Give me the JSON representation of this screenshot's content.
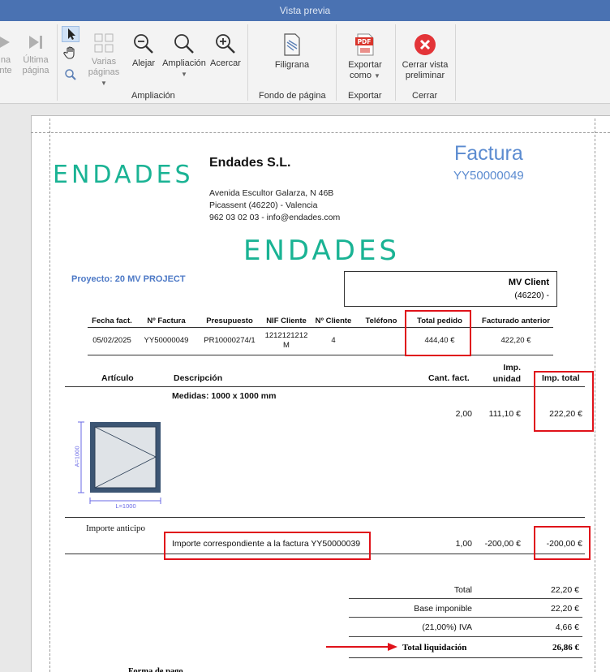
{
  "window": {
    "title": "Vista previa"
  },
  "ribbon": {
    "prev_label_line1": "na",
    "prev_label_line2": "nte",
    "last_label_line1": "Última",
    "last_label_line2": "página",
    "multi_label_line1": "Varias",
    "multi_label_line2": "páginas",
    "zoom_out_label": "Alejar",
    "zoom_label": "Ampliación",
    "zoom_in_label": "Acercar",
    "watermark_label": "Filigrana",
    "export_label_line1": "Exportar",
    "export_label_line2": "como",
    "close_label_line1": "Cerrar vista",
    "close_label_line2": "preliminar",
    "group_zoom": "Ampliación",
    "group_background": "Fondo de página",
    "group_export": "Exportar",
    "group_close": "Cerrar",
    "pdf_badge": "PDF"
  },
  "invoice": {
    "logo_text": "ENDADES",
    "company_name": "Endades S.L.",
    "address_line1": "Avenida Escultor Galarza, N 46B",
    "address_line2": "Picassent (46220) - Valencia",
    "address_line3": "962 03 02 03 - info@endades.com",
    "doc_title": "Factura",
    "doc_number": "YY50000049",
    "project": "Proyecto: 20 MV PROJECT",
    "client_name": "MV Client",
    "client_postal": "(46220)  -",
    "header_cols": [
      "Fecha fact.",
      "Nº Factura",
      "Presupuesto",
      "NIF Cliente",
      "Nº Cliente",
      "Teléfono",
      "Total pedido",
      "Facturado anterior"
    ],
    "header_vals": {
      "fecha": "05/02/2025",
      "factura": "YY50000049",
      "presupuesto": "PR10000274/1",
      "nif_line1": "1212121212",
      "nif_line2": "M",
      "cliente": "4",
      "telefono": "",
      "total_pedido": "444,40 €",
      "facturado_anterior": "422,20 €"
    },
    "items_header": {
      "articulo": "Artículo",
      "descripcion": "Descripción",
      "cant": "Cant. fact.",
      "imp_unidad_line1": "Imp.",
      "imp_unidad_line2": "unidad",
      "imp_total": "Imp. total"
    },
    "item1": {
      "measures": "Medidas: 1000 x 1000 mm",
      "cant": "2,00",
      "unit": "111,10 €",
      "total": "222,20 €",
      "dim_height": "A=1000",
      "dim_width": "L=1000"
    },
    "advance": {
      "section": "Importe anticipo",
      "description": "Importe correspondiente a la factura YY50000039",
      "cant": "1,00",
      "unit": "-200,00 €",
      "total": "-200,00 €"
    },
    "totals": {
      "total_label": "Total",
      "total_value": "22,20 €",
      "base_label": "Base imponible",
      "base_value": "22,20 €",
      "iva_label": "(21,00%) IVA",
      "iva_value": "4,66 €",
      "liq_label": "Total liquidación",
      "liq_value": "26,86 €"
    },
    "payment_label": "Forma de pago"
  },
  "colors": {
    "titlebar": "#4a72b2",
    "logo": "#1ab394",
    "accent_blue": "#5b8bd0",
    "highlight_red": "#e0121a"
  }
}
